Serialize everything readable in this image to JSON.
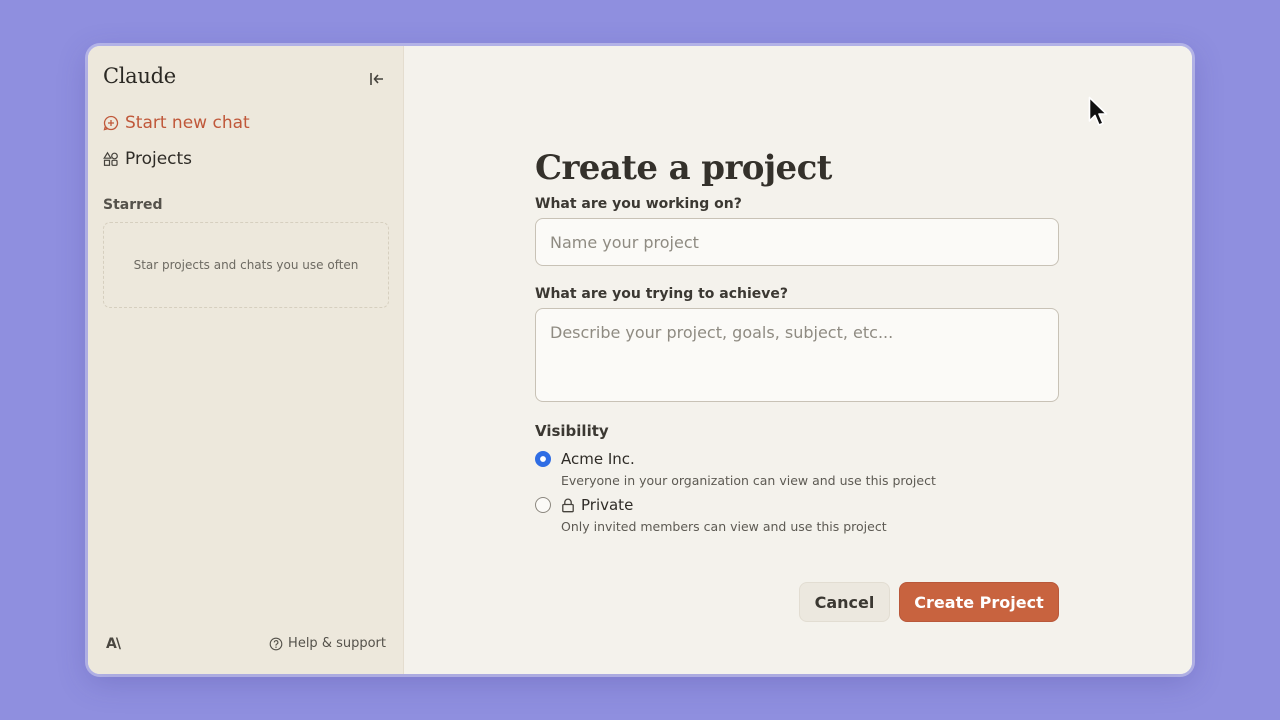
{
  "sidebar": {
    "brand": "Claude",
    "new_chat_label": "Start new chat",
    "projects_label": "Projects",
    "starred_heading": "Starred",
    "starred_empty": "Star projects and chats you use often",
    "logo_text": "A\\",
    "help_label": "Help & support"
  },
  "main": {
    "title": "Create a project",
    "name_label": "What are you working on?",
    "name_placeholder": "Name your project",
    "name_value": "",
    "goal_label": "What are you trying to achieve?",
    "goal_placeholder": "Describe your project, goals, subject, etc...",
    "goal_value": "",
    "visibility_label": "Visibility",
    "options": [
      {
        "name": "Acme Inc.",
        "description": "Everyone in your organization can view and use this project",
        "selected": true
      },
      {
        "name": "Private",
        "description": "Only invited members can view and use this project",
        "selected": false
      }
    ],
    "cancel_label": "Cancel",
    "create_label": "Create Project"
  },
  "colors": {
    "accent": "#c8633f",
    "radio_selected": "#2f6de4",
    "background": "#8f8fdf"
  }
}
